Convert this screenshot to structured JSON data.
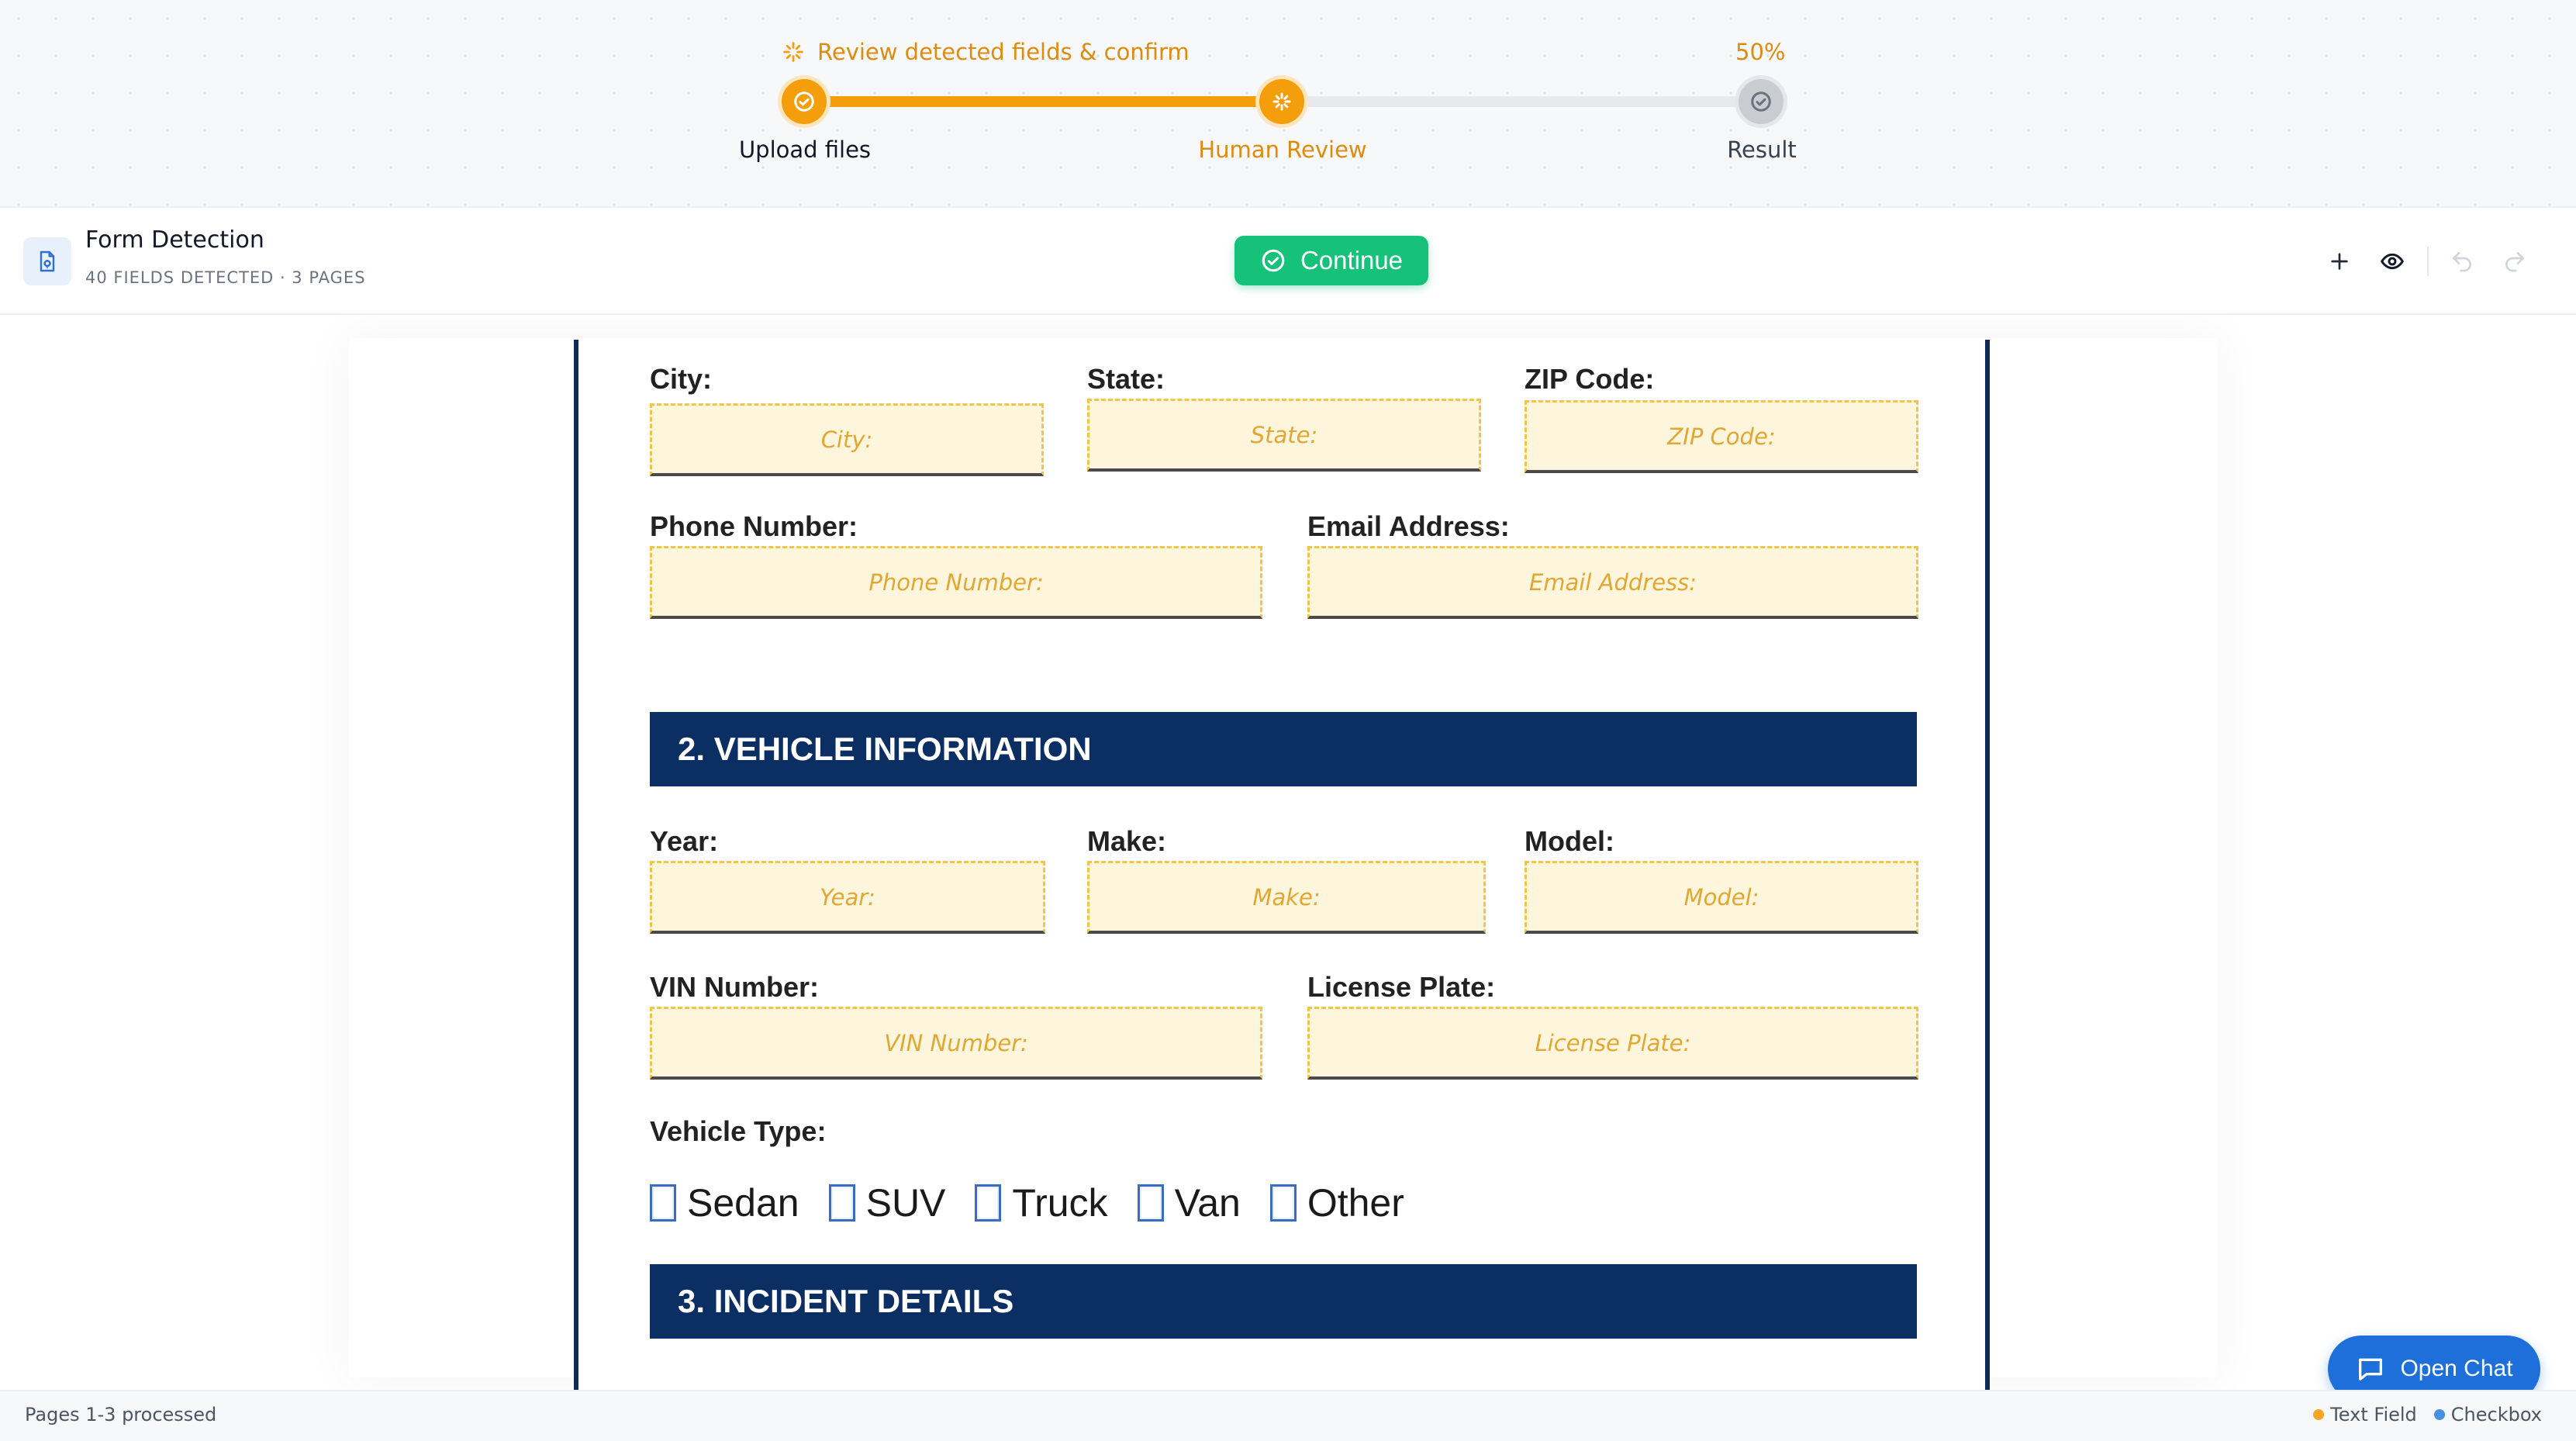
{
  "progress": {
    "caption": "Review detected fields & confirm",
    "percent_label": "50%",
    "percent_value": 50,
    "steps": [
      {
        "label": "Upload files",
        "state": "done"
      },
      {
        "label": "Human Review",
        "state": "current"
      },
      {
        "label": "Result",
        "state": "pending"
      }
    ]
  },
  "toolbar": {
    "doc_title": "Form Detection",
    "doc_subtitle": "40 FIELDS DETECTED · 3 PAGES",
    "continue_label": "Continue",
    "icons": [
      "plus-icon",
      "eye-icon",
      "undo-icon",
      "redo-icon"
    ]
  },
  "form": {
    "row_city": [
      {
        "label": "City:",
        "placeholder": "City:"
      },
      {
        "label": "State:",
        "placeholder": "State:"
      },
      {
        "label": "ZIP Code:",
        "placeholder": "ZIP Code:"
      }
    ],
    "row_contact": [
      {
        "label": "Phone Number:",
        "placeholder": "Phone Number:"
      },
      {
        "label": "Email Address:",
        "placeholder": "Email Address:"
      }
    ],
    "section_vehicle": "2. VEHICLE INFORMATION",
    "row_vehicle": [
      {
        "label": "Year:",
        "placeholder": "Year:"
      },
      {
        "label": "Make:",
        "placeholder": "Make:"
      },
      {
        "label": "Model:",
        "placeholder": "Model:"
      }
    ],
    "row_ids": [
      {
        "label": "VIN Number:",
        "placeholder": "VIN Number:"
      },
      {
        "label": "License Plate:",
        "placeholder": "License Plate:"
      }
    ],
    "vehicle_type_label": "Vehicle Type:",
    "vehicle_types": [
      "Sedan",
      "SUV",
      "Truck",
      "Van",
      "Other"
    ],
    "section_incident": "3. INCIDENT DETAILS"
  },
  "chat": {
    "label": "Open Chat"
  },
  "status": {
    "text": "Pages 1-3 processed",
    "legend": [
      {
        "label": "Text Field",
        "color": "#f5a623"
      },
      {
        "label": "Checkbox",
        "color": "#4a90e2"
      }
    ]
  },
  "colors": {
    "accent": "#f59e0b",
    "success": "#16c27a",
    "navy": "#0c2f63",
    "chat_blue": "#1e6fd9"
  }
}
